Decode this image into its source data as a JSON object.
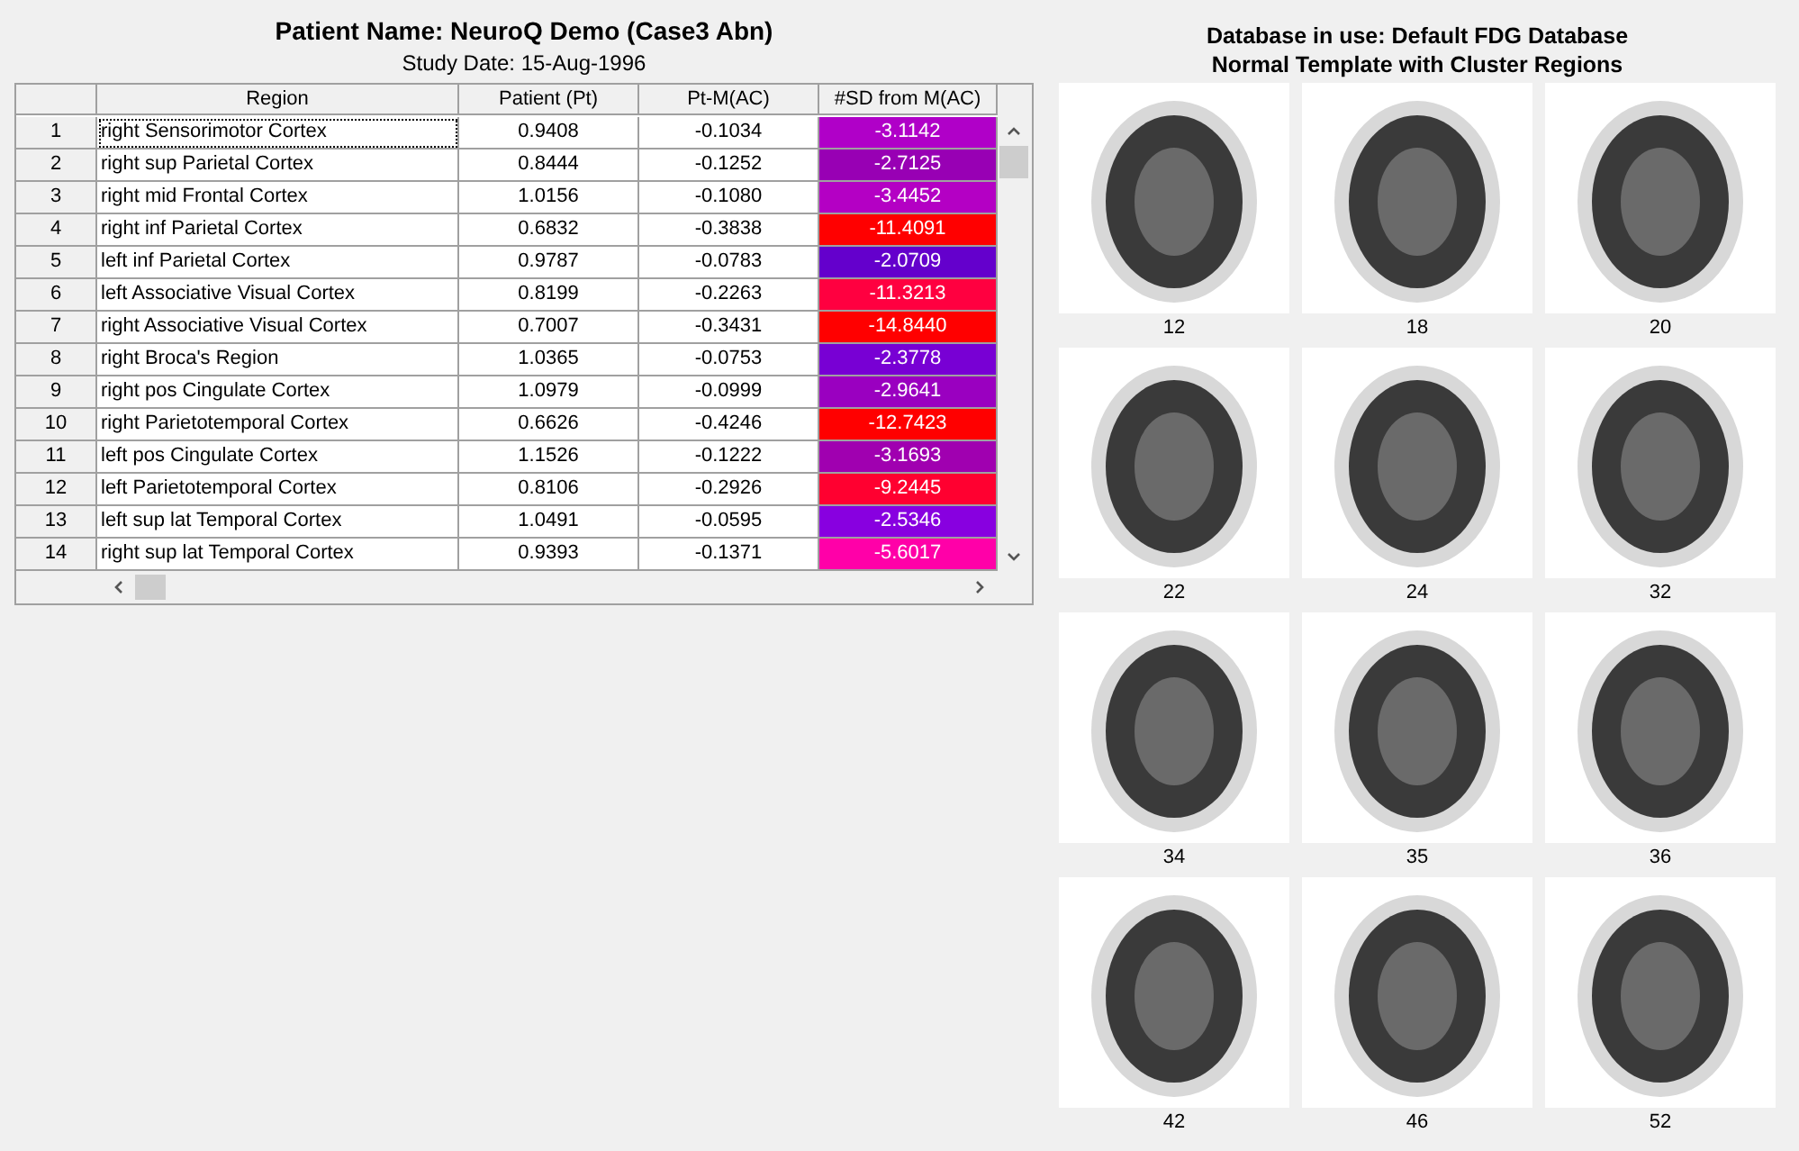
{
  "patient": {
    "title": "Patient Name: NeuroQ Demo (Case3 Abn)",
    "study_date": "Study Date: 15-Aug-1996"
  },
  "table": {
    "columns": [
      "Region",
      "Patient (Pt)",
      "Pt-M(AC)",
      "#SD from M(AC)"
    ],
    "rows": [
      {
        "index": "1",
        "region": "right Sensorimotor Cortex",
        "patient": "0.9408",
        "diff": "-0.1034",
        "sd": "-3.1142",
        "color": "#b000c8",
        "focused": true
      },
      {
        "index": "2",
        "region": "right sup Parietal Cortex",
        "patient": "0.8444",
        "diff": "-0.1252",
        "sd": "-2.7125",
        "color": "#9800b4",
        "focused": false
      },
      {
        "index": "3",
        "region": "right mid Frontal Cortex",
        "patient": "1.0156",
        "diff": "-0.1080",
        "sd": "-3.4452",
        "color": "#b400c4",
        "focused": false
      },
      {
        "index": "4",
        "region": "right inf Parietal Cortex",
        "patient": "0.6832",
        "diff": "-0.3838",
        "sd": "-11.4091",
        "color": "#ff0000",
        "focused": false
      },
      {
        "index": "5",
        "region": "left inf Parietal Cortex",
        "patient": "0.9787",
        "diff": "-0.0783",
        "sd": "-2.0709",
        "color": "#6400cc",
        "focused": false
      },
      {
        "index": "6",
        "region": "left Associative Visual Cortex",
        "patient": "0.8199",
        "diff": "-0.2263",
        "sd": "-11.3213",
        "color": "#ff0040",
        "focused": false
      },
      {
        "index": "7",
        "region": "right Associative Visual Cortex",
        "patient": "0.7007",
        "diff": "-0.3431",
        "sd": "-14.8440",
        "color": "#ff0000",
        "focused": false
      },
      {
        "index": "8",
        "region": "right Broca's Region",
        "patient": "1.0365",
        "diff": "-0.0753",
        "sd": "-2.3778",
        "color": "#7800d4",
        "focused": false
      },
      {
        "index": "9",
        "region": "right pos Cingulate Cortex",
        "patient": "1.0979",
        "diff": "-0.0999",
        "sd": "-2.9641",
        "color": "#9a00c0",
        "focused": false
      },
      {
        "index": "10",
        "region": "right Parietotemporal Cortex",
        "patient": "0.6626",
        "diff": "-0.4246",
        "sd": "-12.7423",
        "color": "#ff0000",
        "focused": false
      },
      {
        "index": "11",
        "region": "left pos Cingulate Cortex",
        "patient": "1.1526",
        "diff": "-0.1222",
        "sd": "-3.1693",
        "color": "#a000b0",
        "focused": false
      },
      {
        "index": "12",
        "region": "left Parietotemporal Cortex",
        "patient": "0.8106",
        "diff": "-0.2926",
        "sd": "-9.2445",
        "color": "#ff0030",
        "focused": false
      },
      {
        "index": "13",
        "region": "left sup lat Temporal Cortex",
        "patient": "1.0491",
        "diff": "-0.0595",
        "sd": "-2.5346",
        "color": "#8800e0",
        "focused": false
      },
      {
        "index": "14",
        "region": "right sup lat Temporal Cortex",
        "patient": "0.9393",
        "diff": "-0.1371",
        "sd": "-5.6017",
        "color": "#ff00a8",
        "focused": false
      }
    ]
  },
  "database": {
    "title": "Database in use: Default FDG Database",
    "subtitle": "Normal Template with Cluster Regions"
  },
  "slices": [
    {
      "label": "12"
    },
    {
      "label": "18"
    },
    {
      "label": "20"
    },
    {
      "label": "22"
    },
    {
      "label": "24"
    },
    {
      "label": "32"
    },
    {
      "label": "34"
    },
    {
      "label": "35"
    },
    {
      "label": "36"
    },
    {
      "label": "42"
    },
    {
      "label": "46"
    },
    {
      "label": "52"
    }
  ]
}
